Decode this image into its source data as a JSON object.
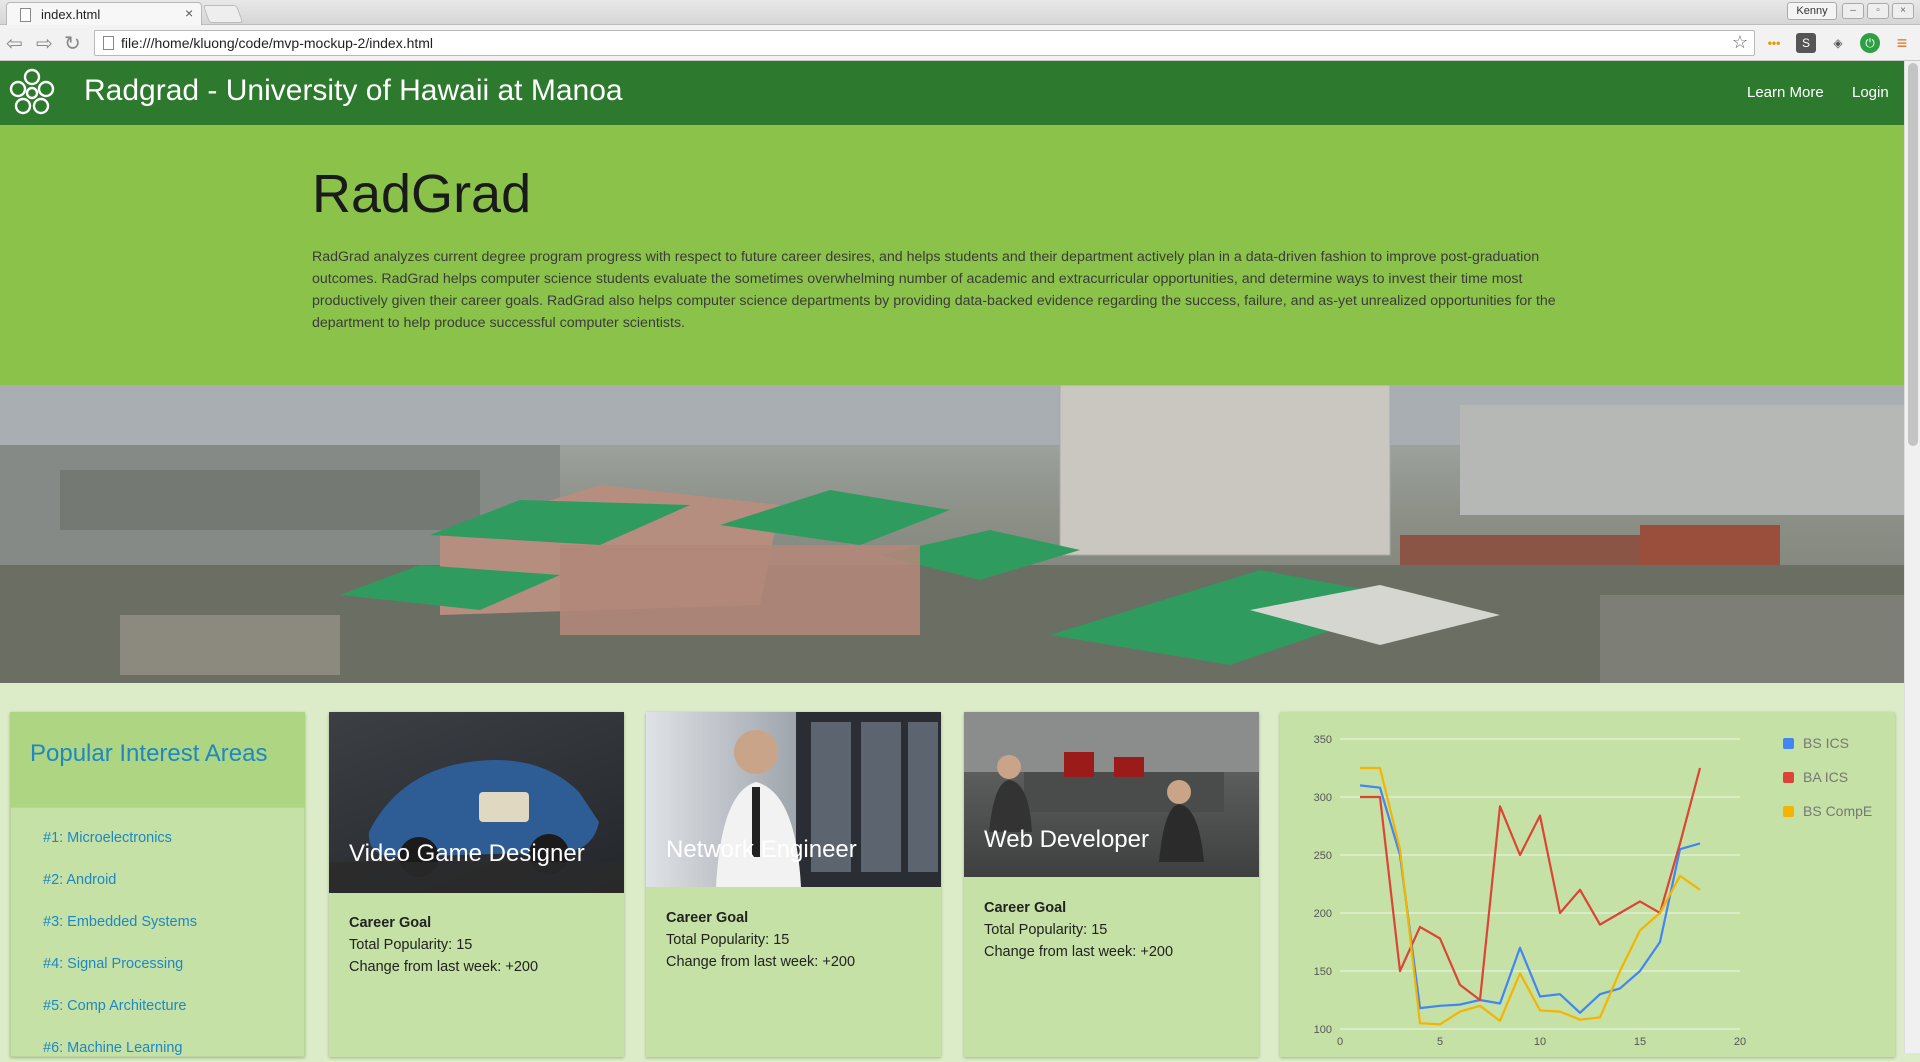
{
  "browser": {
    "tab_title": "index.html",
    "tab_close": "×",
    "user": "Kenny",
    "url": "file:///home/kluong/code/mvp-mockup-2/index.html"
  },
  "navbar": {
    "brand": "Radgrad - University of Hawaii at Manoa",
    "learn_more": "Learn More",
    "login": "Login"
  },
  "hero": {
    "title": "RadGrad",
    "description": "RadGrad analyzes current degree program progress with respect to future career desires, and helps students and their department actively plan in a data-driven fashion to improve post-graduation outcomes. RadGrad helps computer science students evaluate the sometimes overwhelming number of academic and extracurricular opportunities, and determine ways to invest their time most productively given their career goals. RadGrad also helps computer science departments by providing data-backed evidence regarding the success, failure, and as-yet unrealized opportunities for the department to help produce successful computer scientists."
  },
  "interests": {
    "title": "Popular Interest Areas",
    "items": [
      "#1: Microelectronics",
      "#2: Android",
      "#3: Embedded Systems",
      "#4: Signal Processing",
      "#5: Comp Architecture",
      "#6: Machine Learning"
    ]
  },
  "careers": [
    {
      "title": "Video Game Designer",
      "label": "Career Goal",
      "popularity": "Total Popularity: 15",
      "change": "Change from last week: +200"
    },
    {
      "title": "Network Engineer",
      "label": "Career Goal",
      "popularity": "Total Popularity: 15",
      "change": "Change from last week: +200"
    },
    {
      "title": "Web Developer",
      "label": "Career Goal",
      "popularity": "Total Popularity: 15",
      "change": "Change from last week: +200"
    }
  ],
  "colors": {
    "navbar": "#2d7a2f",
    "hero": "#8bc34a",
    "card": "#c5e1a5",
    "link": "#1e88c4"
  },
  "chart_data": {
    "type": "line",
    "xlim": [
      0,
      20
    ],
    "ylim": [
      100,
      350
    ],
    "xticks": [
      0,
      5,
      10,
      15,
      20
    ],
    "yticks": [
      100,
      150,
      200,
      250,
      300,
      350
    ],
    "legend_position": "right",
    "grid": true,
    "series": [
      {
        "name": "BS ICS",
        "color": "#4285f4",
        "x": [
          1,
          2,
          3,
          4,
          5,
          6,
          7,
          8,
          9,
          10,
          11,
          12,
          13,
          14,
          15,
          16,
          17,
          18
        ],
        "values": [
          310,
          308,
          250,
          118,
          120,
          121,
          125,
          122,
          170,
          128,
          130,
          114,
          130,
          135,
          150,
          175,
          255,
          260
        ]
      },
      {
        "name": "BA ICS",
        "color": "#db4437",
        "x": [
          1,
          2,
          3,
          4,
          5,
          6,
          7,
          8,
          9,
          10,
          11,
          12,
          13,
          14,
          15,
          16,
          17,
          18
        ],
        "values": [
          300,
          300,
          150,
          188,
          178,
          138,
          125,
          292,
          250,
          284,
          200,
          220,
          190,
          200,
          210,
          200,
          260,
          325
        ]
      },
      {
        "name": "BS CompE",
        "color": "#f4b400",
        "x": [
          1,
          2,
          3,
          4,
          5,
          6,
          7,
          8,
          9,
          10,
          11,
          12,
          13,
          14,
          15,
          16,
          17,
          18
        ],
        "values": [
          325,
          325,
          255,
          105,
          104,
          115,
          120,
          107,
          148,
          116,
          115,
          108,
          110,
          150,
          185,
          200,
          232,
          220
        ]
      }
    ]
  }
}
